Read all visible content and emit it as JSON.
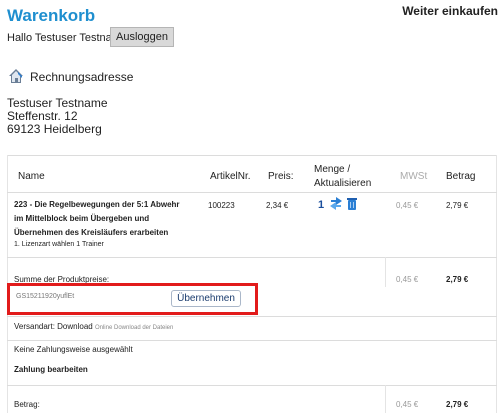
{
  "header": {
    "title": "Warenkorb",
    "continue_label": "Weiter einkaufen",
    "greeting": "Hallo Testuser Testname",
    "logout_label": "Ausloggen"
  },
  "billing": {
    "icon": "house-icon",
    "heading": "Rechnungsadresse",
    "name": "Testuser Testname",
    "street": "Steffenstr. 12",
    "city": "69123 Heidelberg"
  },
  "cart": {
    "headers": {
      "name": "Name",
      "article": "ArtikelNr.",
      "price": "Preis:",
      "quantity_line1": "Menge /",
      "quantity_line2": "Aktualisieren",
      "vat": "MWSt",
      "amount": "Betrag"
    },
    "item": {
      "name_line1": "223 - Die Regelbewegungen der 5:1 Abwehr",
      "name_line2": "im Mittelblock beim Übergeben und",
      "name_line3": "Übernehmen des Kreisläufers erarbeiten",
      "option": "1. Lizenzart wählen 1 Trainer",
      "article_no": "100223",
      "price": "2,34 €",
      "quantity": "1",
      "refresh_icon": "refresh-icon",
      "delete_icon": "trash-icon",
      "vat": "0,45 €",
      "amount": "2,79 €"
    },
    "subtotal": {
      "label": "Summe der Produktpreise:",
      "vat": "0,45 €",
      "amount": "2,79 €"
    },
    "coupon": {
      "value": "GS15211920yuflEt",
      "apply_label": "Übernehmen",
      "highlight_color": "#e21b1b"
    },
    "shipping": {
      "label": "Versandart:",
      "method": "Download",
      "note": "Online Download der Dateien"
    },
    "payment": {
      "none_text": "Keine Zahlungsweise ausgewählt",
      "edit_label": "Zahlung bearbeiten"
    },
    "total": {
      "label": "Betrag:",
      "vat": "0,45 €",
      "amount": "2,79 €"
    }
  },
  "colors": {
    "title": "#1f8fcf",
    "icon_blue": "#2a7fd4"
  }
}
